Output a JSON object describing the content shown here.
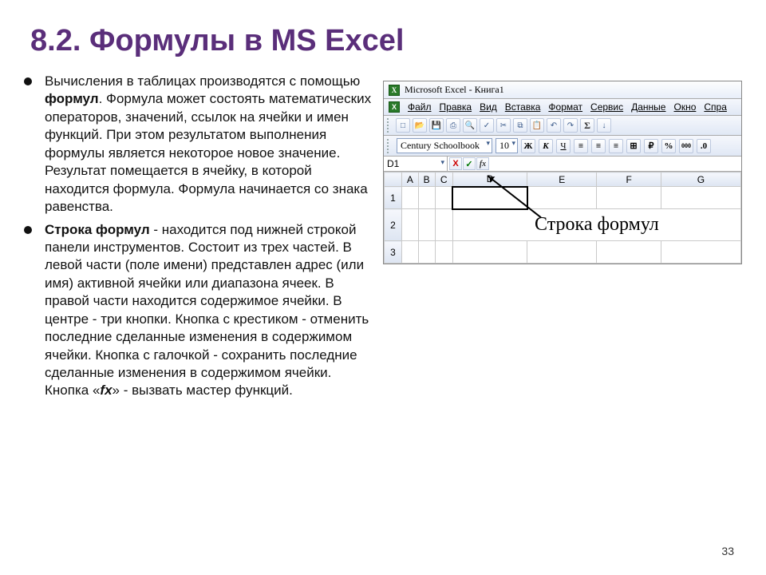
{
  "title": "8.2. Формулы в MS Excel",
  "bullets": [
    {
      "pre": "Вычисления в таблицах производятся с помощью ",
      "bold1": "формул",
      "post": ". Формула может состоять математических операторов, значений, ссылок на ячейки и имен функций. При этом результатом выполнения формулы является некоторое новое значение. Результат помещается в ячейку, в которой находится формула. Формула начинается со знака равенства."
    },
    {
      "bold1": "Строка формул",
      "mid": " - находится под нижней строкой панели инструментов. Состоит из трех частей. В левой части (поле имени) представлен адрес (или имя) активной ячейки или диапазона ячеек. В правой части находится содержимое ячейки. В центре - три кнопки. Кнопка с крестиком - отменить последние сделанные изменения в содержимом ячейки. Кнопка с галочкой - сохранить последние сделанные изменения в содержимом ячейки. Кнопка «",
      "bolditalic": "fx",
      "post": "» - вызвать мастер функций."
    }
  ],
  "excel": {
    "app_title": "Microsoft Excel - Книга1",
    "menus": [
      "Файл",
      "Правка",
      "Вид",
      "Вставка",
      "Формат",
      "Сервис",
      "Данные",
      "Окно",
      "Спра"
    ],
    "font_name": "Century Schoolbook",
    "font_size": "10",
    "style_btns": {
      "bold": "Ж",
      "italic": "К",
      "underline": "Ч"
    },
    "percent": "%",
    "thousands": "000",
    "name_box": "D1",
    "fx_cancel": "X",
    "fx_ok": "✓",
    "fx_fx": "fx",
    "columns": [
      "A",
      "B",
      "C",
      "D",
      "E",
      "F",
      "G"
    ],
    "rows": [
      "1",
      "2",
      "3"
    ],
    "annotation": "Строка формул",
    "sigma": "Σ"
  },
  "page_number": "33"
}
